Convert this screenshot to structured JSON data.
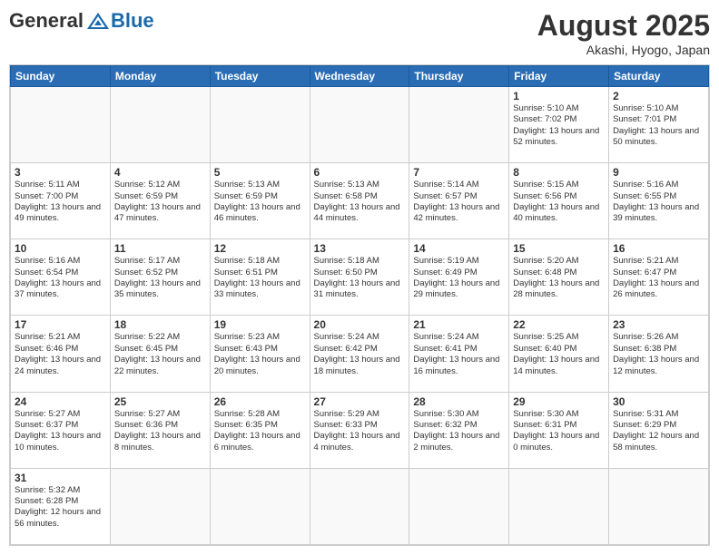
{
  "header": {
    "logo": {
      "general": "General",
      "blue": "Blue"
    },
    "title": "August 2025",
    "location": "Akashi, Hyogo, Japan"
  },
  "weekdays": [
    "Sunday",
    "Monday",
    "Tuesday",
    "Wednesday",
    "Thursday",
    "Friday",
    "Saturday"
  ],
  "weeks": [
    [
      {
        "day": "",
        "info": ""
      },
      {
        "day": "",
        "info": ""
      },
      {
        "day": "",
        "info": ""
      },
      {
        "day": "",
        "info": ""
      },
      {
        "day": "",
        "info": ""
      },
      {
        "day": "1",
        "info": "Sunrise: 5:10 AM\nSunset: 7:02 PM\nDaylight: 13 hours and 52 minutes."
      },
      {
        "day": "2",
        "info": "Sunrise: 5:10 AM\nSunset: 7:01 PM\nDaylight: 13 hours and 50 minutes."
      }
    ],
    [
      {
        "day": "3",
        "info": "Sunrise: 5:11 AM\nSunset: 7:00 PM\nDaylight: 13 hours and 49 minutes."
      },
      {
        "day": "4",
        "info": "Sunrise: 5:12 AM\nSunset: 6:59 PM\nDaylight: 13 hours and 47 minutes."
      },
      {
        "day": "5",
        "info": "Sunrise: 5:13 AM\nSunset: 6:59 PM\nDaylight: 13 hours and 46 minutes."
      },
      {
        "day": "6",
        "info": "Sunrise: 5:13 AM\nSunset: 6:58 PM\nDaylight: 13 hours and 44 minutes."
      },
      {
        "day": "7",
        "info": "Sunrise: 5:14 AM\nSunset: 6:57 PM\nDaylight: 13 hours and 42 minutes."
      },
      {
        "day": "8",
        "info": "Sunrise: 5:15 AM\nSunset: 6:56 PM\nDaylight: 13 hours and 40 minutes."
      },
      {
        "day": "9",
        "info": "Sunrise: 5:16 AM\nSunset: 6:55 PM\nDaylight: 13 hours and 39 minutes."
      }
    ],
    [
      {
        "day": "10",
        "info": "Sunrise: 5:16 AM\nSunset: 6:54 PM\nDaylight: 13 hours and 37 minutes."
      },
      {
        "day": "11",
        "info": "Sunrise: 5:17 AM\nSunset: 6:52 PM\nDaylight: 13 hours and 35 minutes."
      },
      {
        "day": "12",
        "info": "Sunrise: 5:18 AM\nSunset: 6:51 PM\nDaylight: 13 hours and 33 minutes."
      },
      {
        "day": "13",
        "info": "Sunrise: 5:18 AM\nSunset: 6:50 PM\nDaylight: 13 hours and 31 minutes."
      },
      {
        "day": "14",
        "info": "Sunrise: 5:19 AM\nSunset: 6:49 PM\nDaylight: 13 hours and 29 minutes."
      },
      {
        "day": "15",
        "info": "Sunrise: 5:20 AM\nSunset: 6:48 PM\nDaylight: 13 hours and 28 minutes."
      },
      {
        "day": "16",
        "info": "Sunrise: 5:21 AM\nSunset: 6:47 PM\nDaylight: 13 hours and 26 minutes."
      }
    ],
    [
      {
        "day": "17",
        "info": "Sunrise: 5:21 AM\nSunset: 6:46 PM\nDaylight: 13 hours and 24 minutes."
      },
      {
        "day": "18",
        "info": "Sunrise: 5:22 AM\nSunset: 6:45 PM\nDaylight: 13 hours and 22 minutes."
      },
      {
        "day": "19",
        "info": "Sunrise: 5:23 AM\nSunset: 6:43 PM\nDaylight: 13 hours and 20 minutes."
      },
      {
        "day": "20",
        "info": "Sunrise: 5:24 AM\nSunset: 6:42 PM\nDaylight: 13 hours and 18 minutes."
      },
      {
        "day": "21",
        "info": "Sunrise: 5:24 AM\nSunset: 6:41 PM\nDaylight: 13 hours and 16 minutes."
      },
      {
        "day": "22",
        "info": "Sunrise: 5:25 AM\nSunset: 6:40 PM\nDaylight: 13 hours and 14 minutes."
      },
      {
        "day": "23",
        "info": "Sunrise: 5:26 AM\nSunset: 6:38 PM\nDaylight: 13 hours and 12 minutes."
      }
    ],
    [
      {
        "day": "24",
        "info": "Sunrise: 5:27 AM\nSunset: 6:37 PM\nDaylight: 13 hours and 10 minutes."
      },
      {
        "day": "25",
        "info": "Sunrise: 5:27 AM\nSunset: 6:36 PM\nDaylight: 13 hours and 8 minutes."
      },
      {
        "day": "26",
        "info": "Sunrise: 5:28 AM\nSunset: 6:35 PM\nDaylight: 13 hours and 6 minutes."
      },
      {
        "day": "27",
        "info": "Sunrise: 5:29 AM\nSunset: 6:33 PM\nDaylight: 13 hours and 4 minutes."
      },
      {
        "day": "28",
        "info": "Sunrise: 5:30 AM\nSunset: 6:32 PM\nDaylight: 13 hours and 2 minutes."
      },
      {
        "day": "29",
        "info": "Sunrise: 5:30 AM\nSunset: 6:31 PM\nDaylight: 13 hours and 0 minutes."
      },
      {
        "day": "30",
        "info": "Sunrise: 5:31 AM\nSunset: 6:29 PM\nDaylight: 12 hours and 58 minutes."
      }
    ],
    [
      {
        "day": "31",
        "info": "Sunrise: 5:32 AM\nSunset: 6:28 PM\nDaylight: 12 hours and 56 minutes."
      },
      {
        "day": "",
        "info": ""
      },
      {
        "day": "",
        "info": ""
      },
      {
        "day": "",
        "info": ""
      },
      {
        "day": "",
        "info": ""
      },
      {
        "day": "",
        "info": ""
      },
      {
        "day": "",
        "info": ""
      }
    ]
  ]
}
